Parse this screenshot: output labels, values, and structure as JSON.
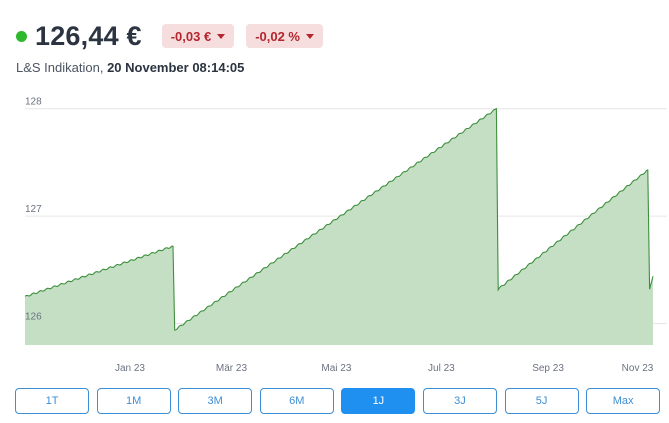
{
  "quote": {
    "status_color": "#2eb82e",
    "price": "126,44 €",
    "change_abs": "-0,03 €",
    "change_pct": "-0,02 %",
    "negative_color": "#b3262e",
    "badge_color": "#f7dede"
  },
  "indication": {
    "source": "L&S Indikation, ",
    "timestamp": "20 November 08:14:05"
  },
  "range_tabs": {
    "active": "1J",
    "items": [
      "1T",
      "1M",
      "3M",
      "6M",
      "1J",
      "3J",
      "5J",
      "Max"
    ]
  },
  "chart_data": {
    "type": "area",
    "title": "",
    "xlabel": "",
    "ylabel": "",
    "grid": true,
    "legend": "none",
    "line_color": "#3d8f3d",
    "fill_color": "#c4dfc4",
    "x_ticks": [
      "Jan 23",
      "Mär 23",
      "Mai 23",
      "Jul 23",
      "Sep 23",
      "Nov 23"
    ],
    "y_ticks": [
      126,
      127,
      128
    ],
    "ylim": [
      125.8,
      128.1
    ],
    "series": [
      {
        "x": [
          "2022-11-20",
          "2023-02-14",
          "2023-02-15",
          "2023-08-21",
          "2023-08-22",
          "2023-11-17",
          "2023-11-18",
          "2023-11-20"
        ],
        "values": [
          126.25,
          126.72,
          125.94,
          128.0,
          126.32,
          127.43,
          126.32,
          126.44
        ]
      }
    ]
  }
}
